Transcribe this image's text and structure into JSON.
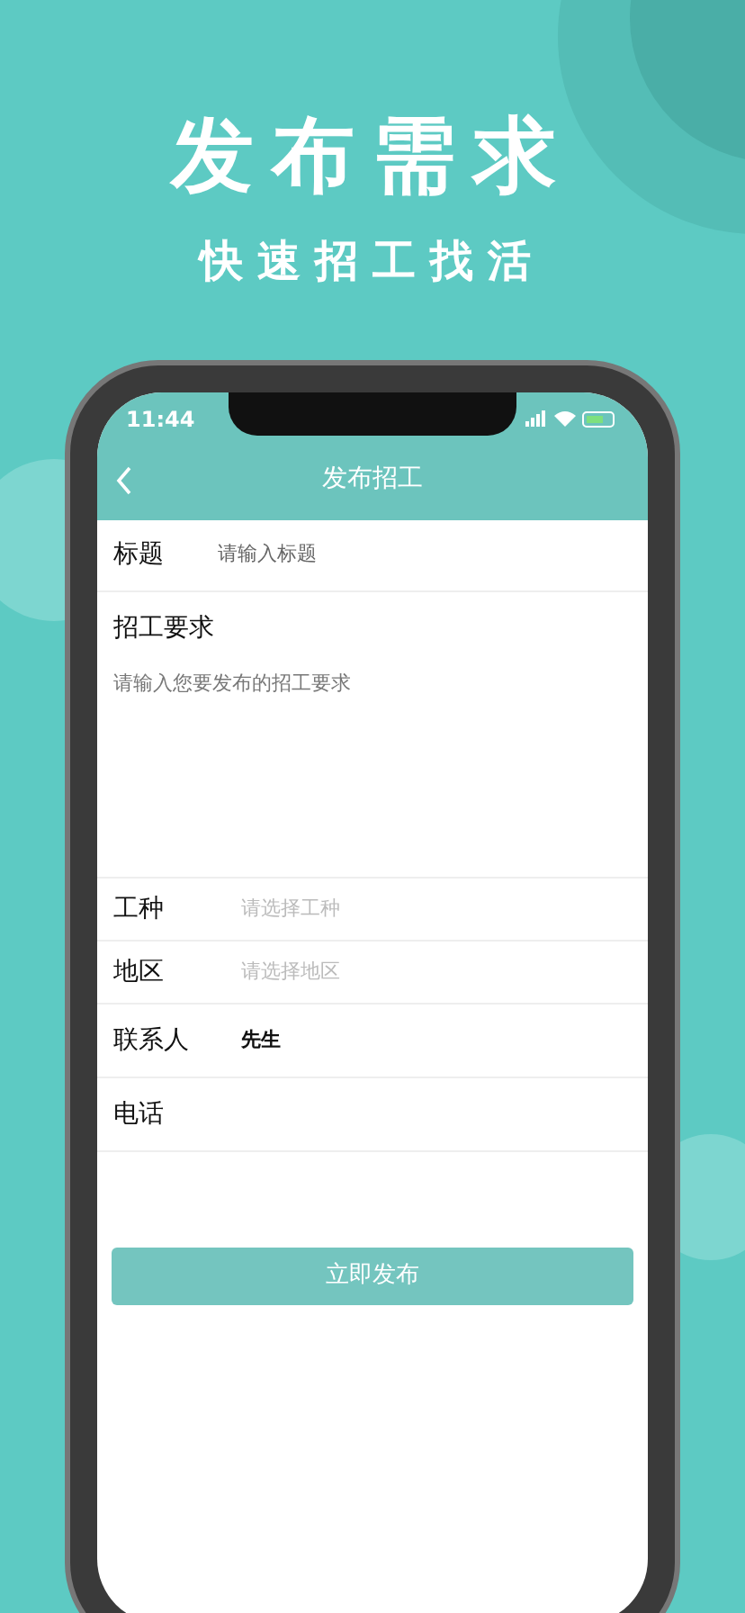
{
  "headline": "发布需求",
  "subheadline": "快速招工找活",
  "status_bar": {
    "time": "11:44"
  },
  "nav": {
    "title": "发布招工"
  },
  "form": {
    "fields": [
      {
        "kind": "input",
        "label": "标题",
        "placeholder": "请输入标题"
      },
      {
        "kind": "textarea",
        "label": "招工要求",
        "placeholder": "请输入您要发布的招工要求"
      },
      {
        "kind": "select",
        "label": "工种",
        "placeholder": "请选择工种"
      },
      {
        "kind": "select",
        "label": "地区",
        "placeholder": "请选择地区"
      },
      {
        "kind": "input",
        "label": "联系人",
        "value": "先生"
      },
      {
        "kind": "input",
        "label": "电话"
      }
    ]
  },
  "submit_button": "立即发布"
}
